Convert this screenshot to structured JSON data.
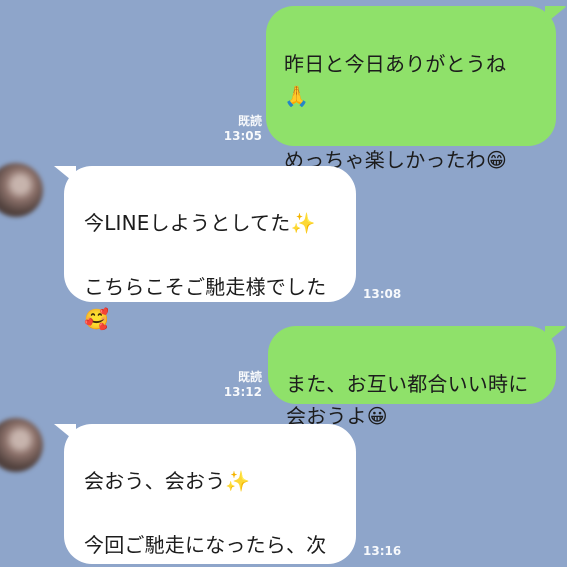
{
  "chat": {
    "messages": [
      {
        "side": "out",
        "text": "昨日と今日ありがとうね\n🙏\n\nめっちゃ楽しかったわ😁",
        "read": "既読",
        "time": "13:05"
      },
      {
        "side": "in",
        "text": "今LINEしようとしてた✨\n\nこちらこそご馳走様でした\n🥰",
        "time": "13:08"
      },
      {
        "side": "out",
        "text": "また、お互い都合いい時に\n会おうよ😀",
        "read": "既読",
        "time": "13:12"
      },
      {
        "side": "in",
        "text": "会おう、会おう✨\n\n今回ご馳走になったら、次\nは私が何かするね👍",
        "time": "13:16"
      }
    ]
  },
  "colors": {
    "background": "#8ea5ca",
    "sent_bubble": "#8fe16a",
    "received_bubble": "#ffffff",
    "meta_text": "#f7f9fc"
  }
}
